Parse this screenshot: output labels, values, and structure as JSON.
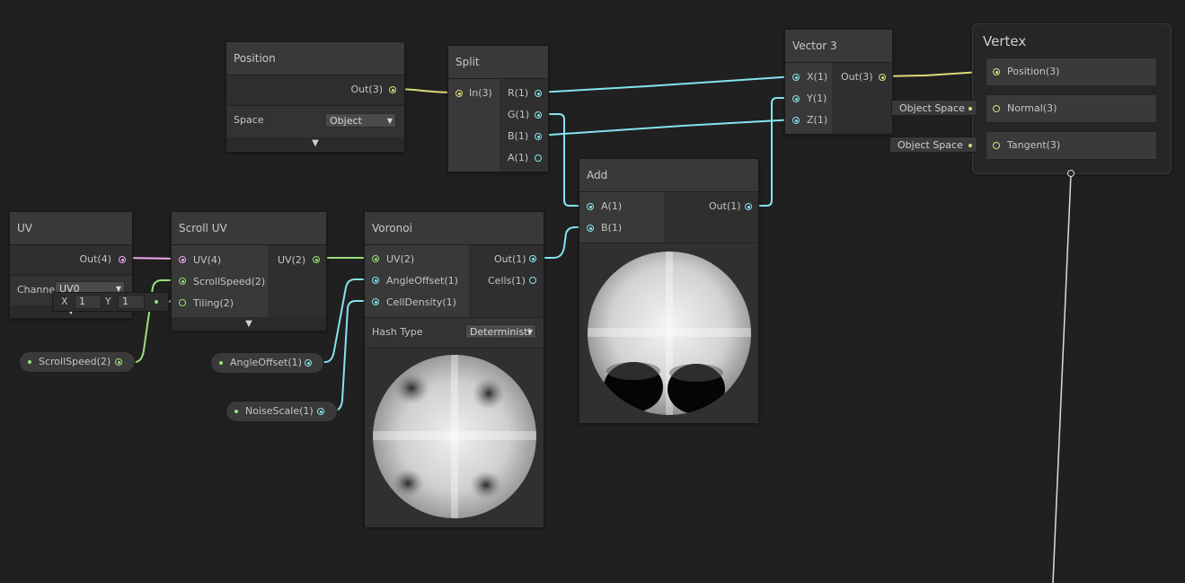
{
  "colors": {
    "background": "#202020",
    "vector3_wire": "#dcdc7c",
    "float_wire": "#84e4f0",
    "vector2_wire": "#9ae07a",
    "vector4_wire": "#f0a8f0"
  },
  "nodes": {
    "position": {
      "title": "Position",
      "out_label": "Out(3)",
      "space_label": "Space",
      "space_value": "Object"
    },
    "split": {
      "title": "Split",
      "in_label": "In(3)",
      "outputs": [
        "R(1)",
        "G(1)",
        "B(1)",
        "A(1)"
      ]
    },
    "vector3": {
      "title": "Vector 3",
      "inputs": [
        "X(1)",
        "Y(1)",
        "Z(1)"
      ],
      "out_label": "Out(3)"
    },
    "vertex": {
      "title": "Vertex",
      "slots": [
        "Position(3)",
        "Normal(3)",
        "Tangent(3)"
      ],
      "normal_space": "Object Space",
      "tangent_space": "Object Space"
    },
    "uv": {
      "title": "UV",
      "out_label": "Out(4)",
      "channel_label": "Channe",
      "channel_value": "UV0"
    },
    "scroll_uv": {
      "title": "Scroll UV",
      "inputs": [
        "UV(4)",
        "ScrollSpeed(2)",
        "Tiling(2)"
      ],
      "out_label": "UV(2)",
      "tiling_x_label": "X",
      "tiling_x_value": "1",
      "tiling_y_label": "Y",
      "tiling_y_value": "1"
    },
    "voronoi": {
      "title": "Voronoi",
      "inputs": [
        "UV(2)",
        "AngleOffset(1)",
        "CellDensity(1)"
      ],
      "outputs": [
        "Out(1)",
        "Cells(1)"
      ],
      "hash_type_label": "Hash Type",
      "hash_type_value": "Deterministi"
    },
    "add": {
      "title": "Add",
      "inputs": [
        "A(1)",
        "B(1)"
      ],
      "out_label": "Out(1)"
    }
  },
  "properties": {
    "scroll_speed": "ScrollSpeed(2)",
    "angle_offset": "AngleOffset(1)",
    "noise_scale": "NoiseScale(1)"
  }
}
